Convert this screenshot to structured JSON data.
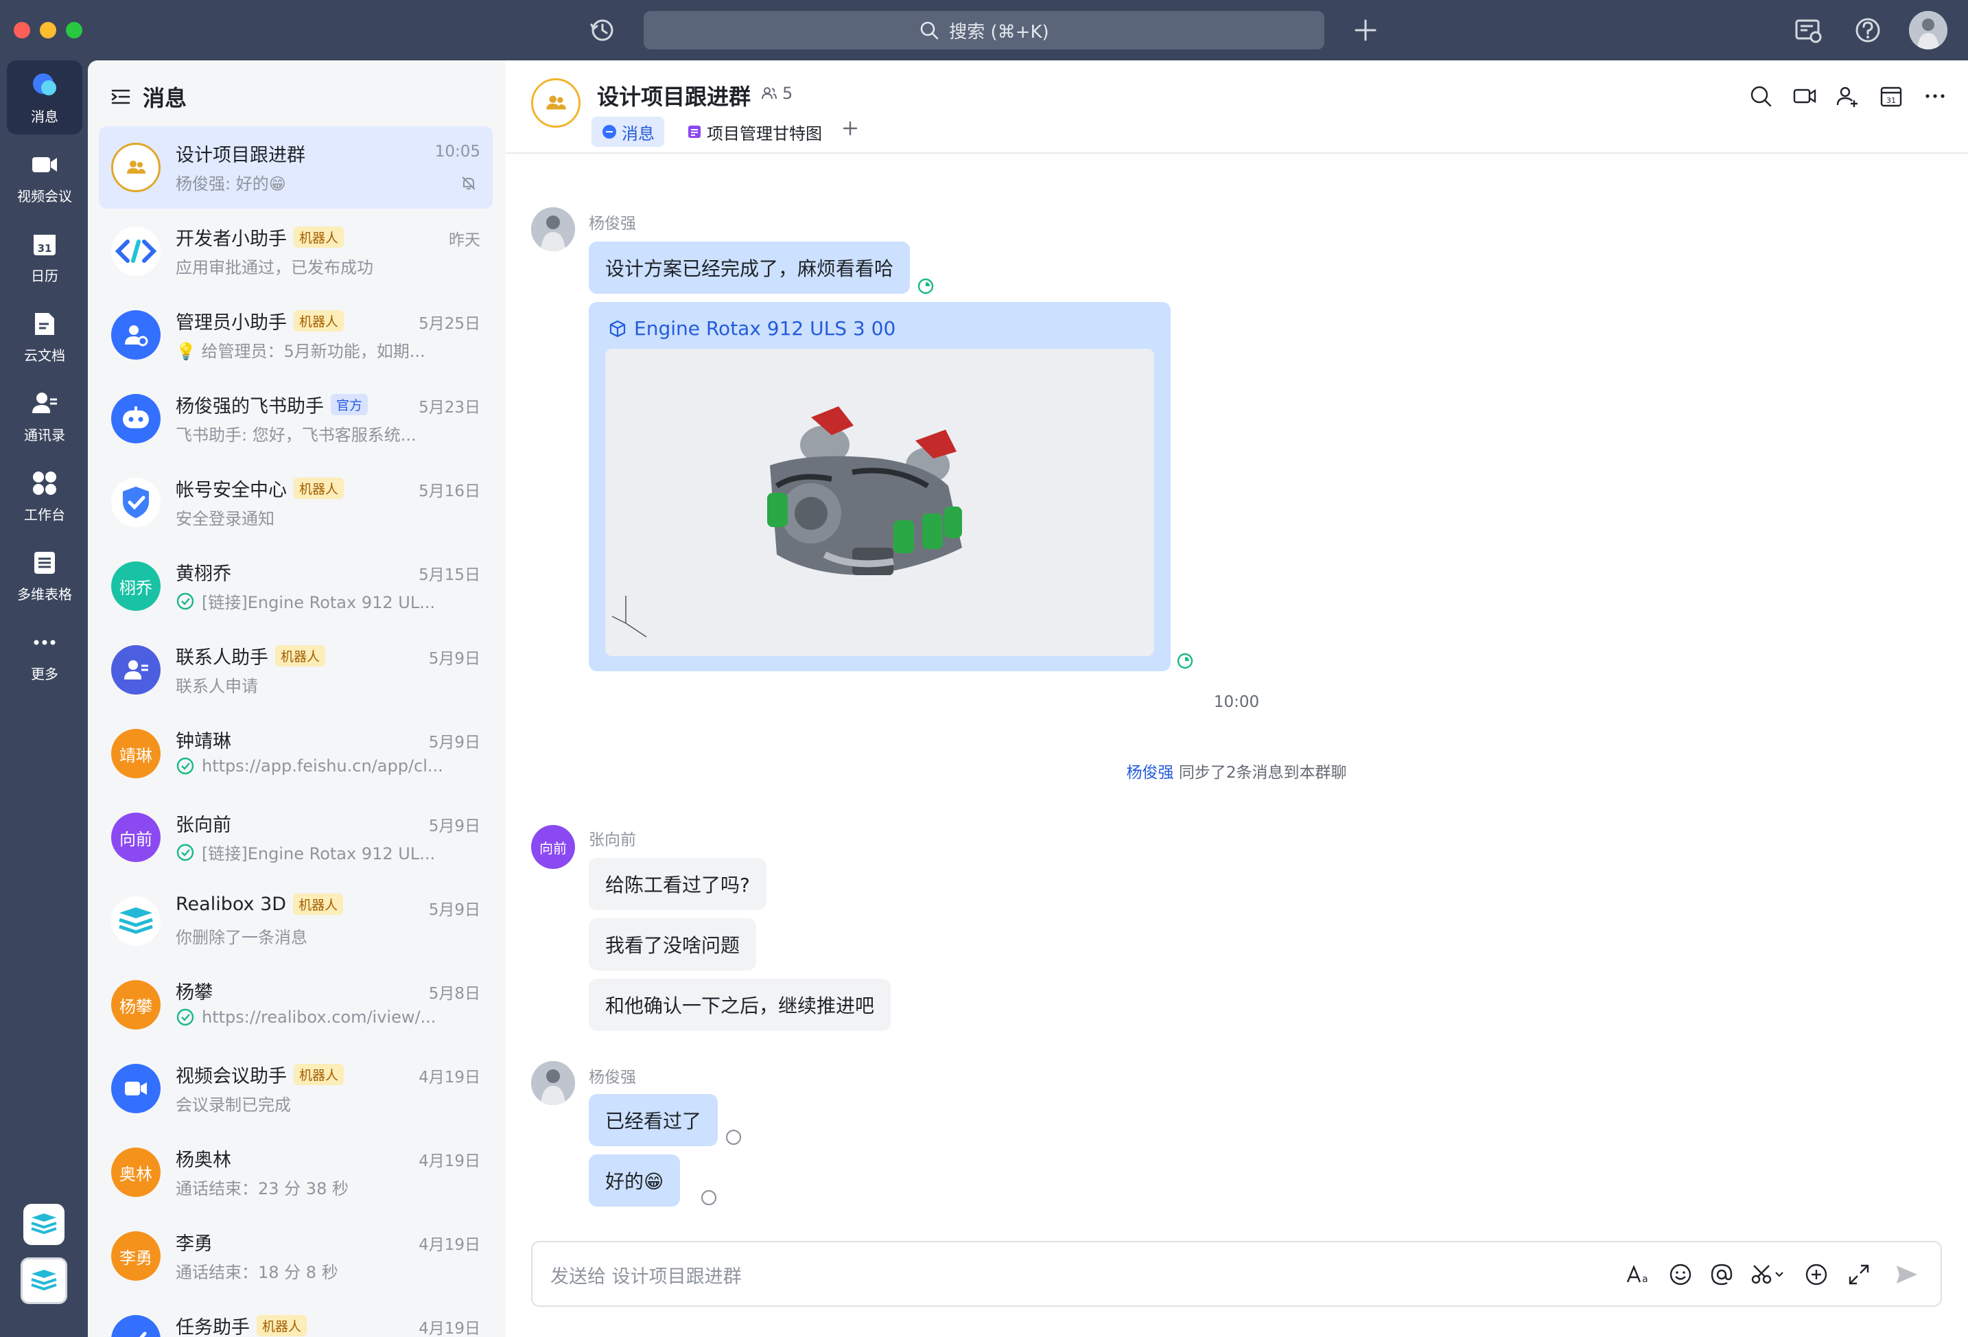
{
  "titlebar": {
    "search_placeholder": "搜索 (⌘+K)"
  },
  "nav": {
    "items": [
      {
        "label": "消息",
        "icon": "chat-bubble-icon",
        "active": true
      },
      {
        "label": "视频会议",
        "icon": "video-camera-icon"
      },
      {
        "label": "日历",
        "icon": "calendar-icon",
        "badge": "31"
      },
      {
        "label": "云文档",
        "icon": "cloud-doc-icon"
      },
      {
        "label": "通讯录",
        "icon": "contacts-icon"
      },
      {
        "label": "工作台",
        "icon": "workspace-grid-icon"
      },
      {
        "label": "多维表格",
        "icon": "base-table-icon"
      },
      {
        "label": "更多",
        "icon": "more-dots-icon"
      }
    ]
  },
  "chatlist": {
    "title": "消息",
    "conversations": [
      {
        "name": "设计项目跟进群",
        "time": "10:05",
        "preview": "杨俊强: 好的😁",
        "muted": true,
        "active": true
      },
      {
        "name": "开发者小助手",
        "tag": "机器人",
        "time": "昨天",
        "preview": "应用审批通过，已发布成功"
      },
      {
        "name": "管理员小助手",
        "tag": "机器人",
        "time": "5月25日",
        "preview": "💡 给管理员：5月新功能，如期..."
      },
      {
        "name": "杨俊强的飞书助手",
        "tag": "官方",
        "time": "5月23日",
        "preview": "飞书助手: 您好，飞书客服系统..."
      },
      {
        "name": "帐号安全中心",
        "tag": "机器人",
        "time": "5月16日",
        "preview": "安全登录通知"
      },
      {
        "name": "黄栩乔",
        "avatar_text": "栩乔",
        "time": "5月15日",
        "preview": "[链接]Engine Rotax 912 UL..."
      },
      {
        "name": "联系人助手",
        "tag": "机器人",
        "time": "5月9日",
        "preview": "联系人申请"
      },
      {
        "name": "钟靖琳",
        "avatar_text": "靖琳",
        "time": "5月9日",
        "preview": "https://app.feishu.cn/app/cl..."
      },
      {
        "name": "张向前",
        "avatar_text": "向前",
        "time": "5月9日",
        "preview": "[链接]Engine Rotax 912 UL..."
      },
      {
        "name": "Realibox 3D",
        "tag": "机器人",
        "time": "5月9日",
        "preview": "你删除了一条消息"
      },
      {
        "name": "杨攀",
        "avatar_text": "杨攀",
        "time": "5月8日",
        "preview": "https://realibox.com/iview/..."
      },
      {
        "name": "视频会议助手",
        "tag": "机器人",
        "time": "4月19日",
        "preview": "会议录制已完成"
      },
      {
        "name": "杨奥林",
        "avatar_text": "奥林",
        "time": "4月19日",
        "preview": "通话结束：23 分 38 秒"
      },
      {
        "name": "李勇",
        "avatar_text": "李勇",
        "time": "4月19日",
        "preview": "通话结束：18 分 8 秒"
      },
      {
        "name": "任务助手",
        "tag": "机器人",
        "time": "4月19日",
        "preview": ""
      }
    ]
  },
  "chat": {
    "title": "设计项目跟进群",
    "member_count": "5",
    "tabs": [
      {
        "label": "消息",
        "active": true
      },
      {
        "label": "项目管理甘特图"
      }
    ],
    "messages": {
      "sender1": "杨俊强",
      "m1": "设计方案已经完成了，麻烦看看哈",
      "card_title": "Engine Rotax 912 ULS 3 00",
      "time1": "10:00",
      "sys_who": "杨俊强",
      "sys_text": " 同步了2条消息到本群聊",
      "sender2": "张向前",
      "sender2_avatar": "向前",
      "m2": "给陈工看过了吗?",
      "m3": "我看了没啥问题",
      "m4": "和他确认一下之后，继续推进吧",
      "sender3": "杨俊强",
      "m5": "已经看过了",
      "m6": "好的😁"
    },
    "composer_placeholder": "发送给 设计项目跟进群"
  },
  "colors": {
    "nav_bg": "#3b465e",
    "accent": "#245bdb",
    "bubble_mine": "#cce0ff",
    "bubble_other": "#f2f3f5"
  }
}
